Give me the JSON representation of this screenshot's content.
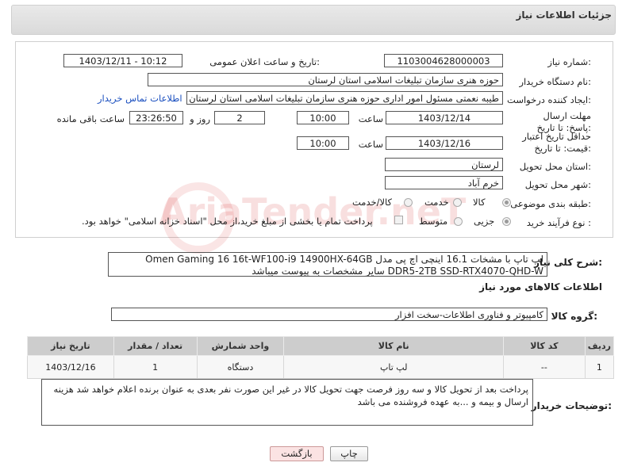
{
  "panel": {
    "title": "جزئیات اطلاعات نیاز"
  },
  "fields": {
    "need_number_label": "شماره نیاز:",
    "need_number": "1103004628000003",
    "announce_label": "تاریخ و ساعت اعلان عمومی:",
    "announce_value": "1403/12/11 - 10:12",
    "buyer_org_label": "نام دستگاه خریدار:",
    "buyer_org": "حوزه هنری سازمان تبلیغات اسلامی استان لرستان",
    "requester_label": "ایجاد کننده درخواست:",
    "requester": "طیبه نعمتی مسئول امور اداری حوزه هنری سازمان تبلیغات اسلامی استان لرستان",
    "buyer_contact_link": "اطلاعات تماس خریدار",
    "reply_deadline_label": "مهلت ارسال پاسخ: تا تاریخ:",
    "reply_date": "1403/12/14",
    "time_label": "ساعت",
    "reply_time": "10:00",
    "days_value": "2",
    "days_label": "روز و",
    "remaining_time": "23:26:50",
    "remaining_label": "ساعت باقی مانده",
    "price_validity_label": "حداقل تاریخ اعتبار قیمت: تا تاریخ:",
    "price_date": "1403/12/16",
    "price_time": "10:00",
    "province_label": "استان محل تحویل:",
    "province": "لرستان",
    "city_label": "شهر محل تحویل:",
    "city": "خرم آباد",
    "category_label": "طبقه بندی موضوعی:",
    "category_options": [
      "کالا",
      "خدمت",
      "کالا/خدمت"
    ],
    "purchase_type_label": "نوع فرآیند خرید :",
    "purchase_options": [
      "جزیی",
      "متوسط"
    ],
    "payment_note": "پرداخت تمام یا بخشی از مبلغ خرید،از محل \"اسناد خزانه اسلامی\" خواهد بود."
  },
  "description": {
    "label": "شرح کلی نیاز:",
    "text": "لپ تاپ با مشخات  16.1 اینچی اچ پی مدل Omen Gaming 16 16t-WF100-i9 14900HX-64GB DDR5-2TB SSD-RTX4070-QHD-W سایر مشخصات به پیوست میباشد"
  },
  "goods": {
    "section_title": "اطلاعات کالاهای مورد نیاز",
    "group_label": "گروه کالا:",
    "group_value": "کامپیوتر و فناوری اطلاعات-سخت افزار",
    "columns": [
      "ردیف",
      "کد کالا",
      "نام کالا",
      "واحد شمارش",
      "تعداد / مقدار",
      "تاریخ نیاز"
    ],
    "rows": [
      {
        "row": "1",
        "code": "--",
        "name": "لپ تاپ",
        "unit": "دستگاه",
        "qty": "1",
        "date": "1403/12/16"
      }
    ]
  },
  "notes": {
    "label": "توضیحات خریدار:",
    "text": "پرداخت بعد از تحویل کالا و سه روز فرصت جهت تحویل کالا در غیر این صورت نفر بعدی به عنوان برنده اعلام خواهد شد هزینه ارسال و بیمه و ...به عهده فروشنده می باشد"
  },
  "buttons": {
    "print": "چاپ",
    "back": "بازگشت"
  },
  "watermark": "AriaTender.neT"
}
